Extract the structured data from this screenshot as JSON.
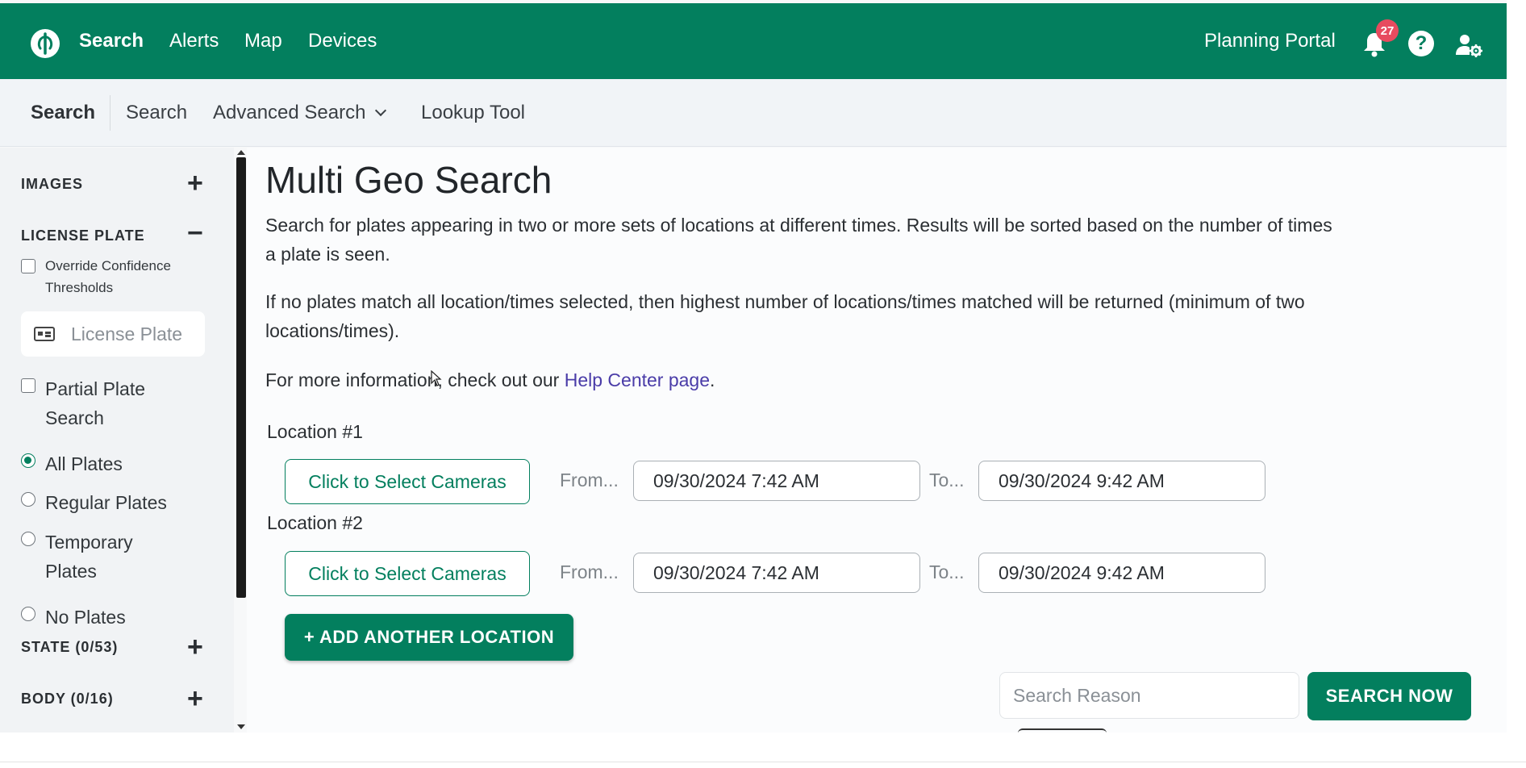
{
  "topnav": {
    "items": [
      {
        "label": "Search",
        "active": true
      },
      {
        "label": "Alerts"
      },
      {
        "label": "Map"
      },
      {
        "label": "Devices"
      }
    ],
    "portal_label": "Planning Portal",
    "notification_count": "27",
    "help_glyph": "?",
    "icons": [
      "logo-icon",
      "bell-icon",
      "help-icon",
      "user-settings-icon"
    ],
    "brand_color": "#037f5e",
    "badge_color": "#e74b5f"
  },
  "subnav": {
    "section_title": "Search",
    "items": [
      "Search",
      "Advanced Search",
      "Lookup Tool"
    ]
  },
  "sidebar": {
    "images_heading": "IMAGES",
    "images_toggle": "+",
    "license_heading": "LICENSE PLATE",
    "license_toggle": "−",
    "override_label": "Override Confidence Thresholds",
    "override_line1": "Override Confidence",
    "override_line2": "Thresholds",
    "plate_placeholder": "License Plate",
    "partial_line1": "Partial Plate",
    "partial_line2": "Search",
    "radios": [
      {
        "label": "All Plates",
        "checked": true
      },
      {
        "label": "Regular Plates",
        "checked": false
      },
      {
        "label": "Temporary",
        "label2": "Plates",
        "checked": false
      },
      {
        "label": "No Plates",
        "checked": false
      }
    ],
    "state_heading": "STATE (0/53)",
    "state_toggle": "+",
    "body_heading": "BODY (0/16)",
    "body_toggle": "+"
  },
  "main": {
    "title": "Multi Geo Search",
    "desc1_line1": "Search for plates appearing in two or more sets of locations at different times. Results will be sorted based on the number of times",
    "desc1_line2": "a plate is seen.",
    "desc2_line1": "If no plates match all location/times selected, then highest number of locations/times matched will be returned (minimum of two",
    "desc2_line2": "locations/times).",
    "info_prefix": "For more information, check out our ",
    "info_link": "Help Center page",
    "info_suffix": ".",
    "locations": [
      {
        "label": "Location #1",
        "camera_button": "Click to Select Cameras",
        "from_label": "From...",
        "from_value": "09/30/2024 7:42 AM",
        "to_label": "To...",
        "to_value": "09/30/2024 9:42 AM"
      },
      {
        "label": "Location #2",
        "camera_button": "Click to Select Cameras",
        "from_label": "From...",
        "from_value": "09/30/2024 7:42 AM",
        "to_label": "To...",
        "to_value": "09/30/2024 9:42 AM"
      }
    ],
    "add_location_label": "+ ADD ANOTHER LOCATION",
    "reason_placeholder": "Search Reason",
    "search_now_label": "SEARCH NOW"
  }
}
